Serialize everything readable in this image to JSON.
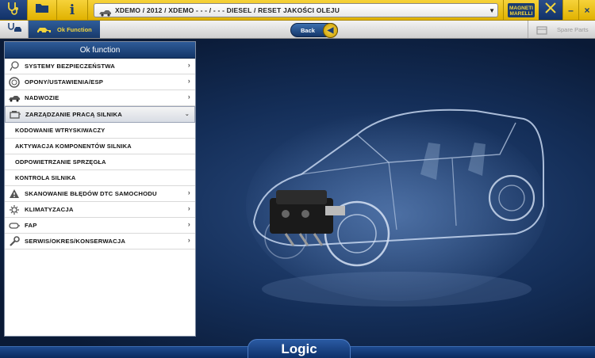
{
  "topbar": {
    "path": "XDEMO / 2012 / XDEMO - - - / - - - DIESEL / RESET JAKOŚCI OLEJU",
    "brand": "MAGNETI MARELLI",
    "icons": [
      "stethoscope-icon",
      "folder-icon",
      "info-icon",
      "car-icon",
      "tools-icon",
      "minimize-icon",
      "close-icon"
    ]
  },
  "subbar": {
    "active_tab": "Ok Function",
    "back_label": "Back",
    "spare_parts_label": "Spare Parts"
  },
  "panel": {
    "title": "Ok function",
    "items": [
      {
        "label": "SYSTEMY BEZPIECZEŃSTWA",
        "icon": "airbag-icon"
      },
      {
        "label": "OPONY/USTAWIENIA/ESP",
        "icon": "tire-icon"
      },
      {
        "label": "NADWOZIE",
        "icon": "car-body-icon"
      },
      {
        "label": "ZARZĄDZANIE PRACĄ SILNIKA",
        "icon": "engine-icon",
        "expanded": true
      },
      {
        "label": "KODOWANIE WTRYSKIWACZY",
        "sub": true
      },
      {
        "label": "AKTYWACJA KOMPONENTÓW SILNIKA",
        "sub": true
      },
      {
        "label": "ODPOWIETRZANIE SPRZĘGŁA",
        "sub": true
      },
      {
        "label": "KONTROLA SILNIKA",
        "sub": true
      },
      {
        "label": "SKANOWANIE BŁĘDÓW DTC SAMOCHODU",
        "icon": "warning-icon"
      },
      {
        "label": "KLIMATYZACJA",
        "icon": "climate-icon"
      },
      {
        "label": "FAP",
        "icon": "particulate-filter-icon"
      },
      {
        "label": "SERWIS/OKRES/KONSERWACJA",
        "icon": "wrench-icon"
      }
    ]
  },
  "footer": {
    "logo": "Logic"
  },
  "colors": {
    "topbar": "#f2c81c",
    "panel_header": "#1f4a84",
    "background": "#142e58"
  }
}
